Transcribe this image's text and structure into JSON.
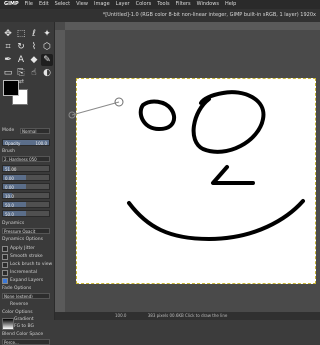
{
  "menubar": {
    "app_name": "GIMP",
    "items": [
      "File",
      "Edit",
      "Select",
      "View",
      "Image",
      "Layer",
      "Colors",
      "Tools",
      "Filters",
      "Windows",
      "Help"
    ]
  },
  "window": {
    "title": "*[Untitled]-1.0 (RGB color 8-bit non-linear integer, GIMP built-in sRGB, 1 layer) 1920x"
  },
  "colors": {
    "foreground": "#000000",
    "background": "#ffffff"
  },
  "tool_options": {
    "mode_label": "Mode",
    "mode_value": "Normal",
    "opacity_label": "Opacity",
    "opacity_value": "100.0",
    "brush_label": "Brush",
    "brush_value": "2. Hardness 050",
    "size_value": "51.00",
    "aspect_value": "0.00",
    "angle_value": "0.00",
    "spacing_value": "10.0",
    "hardness_value": "50.0",
    "force_value": "50.0",
    "dynamics_label": "Dynamics",
    "dynamics_value": "Pressure Opacit",
    "dynamics_options_label": "Dynamics Options",
    "apply_jitter_label": "Apply Jitter",
    "smooth_stroke_label": "Smooth stroke",
    "lock_brush_label": "Lock brush to view",
    "incremental_label": "Incremental",
    "expand_label": "Expand Layers",
    "fade_label": "Fade Options",
    "fade_value": "None (extend)",
    "reverse_label": "Reverse",
    "color_options_label": "Color Options",
    "gradient_label": "Gradient",
    "gradient_value": "FG to BG",
    "blend_label": "Blend Color Space",
    "blend_value": "Perce..."
  },
  "status": {
    "zoom": "100.0",
    "info": "383 pixels 00.6KB Click to draw the line"
  }
}
